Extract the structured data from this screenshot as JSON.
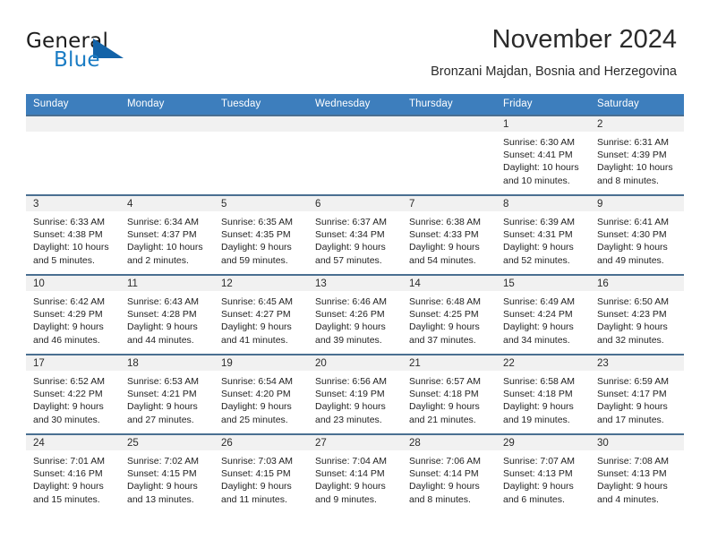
{
  "brand": {
    "name_top": "General",
    "name_bottom": "Blue",
    "triangle_color": "#1363a8",
    "blue_color": "#1a7cc4"
  },
  "header": {
    "month_title": "November 2024",
    "location": "Bronzani Majdan, Bosnia and Herzegovina"
  },
  "theme": {
    "header_blue": "#3d7ebd",
    "row_border": "#4a6f91",
    "daynum_band": "#f1f1f1"
  },
  "calendar": {
    "weekday_headers": [
      "Sunday",
      "Monday",
      "Tuesday",
      "Wednesday",
      "Thursday",
      "Friday",
      "Saturday"
    ],
    "weeks": [
      [
        {
          "day": "",
          "sunrise": "",
          "sunset": "",
          "daylight": ""
        },
        {
          "day": "",
          "sunrise": "",
          "sunset": "",
          "daylight": ""
        },
        {
          "day": "",
          "sunrise": "",
          "sunset": "",
          "daylight": ""
        },
        {
          "day": "",
          "sunrise": "",
          "sunset": "",
          "daylight": ""
        },
        {
          "day": "",
          "sunrise": "",
          "sunset": "",
          "daylight": ""
        },
        {
          "day": "1",
          "sunrise": "Sunrise: 6:30 AM",
          "sunset": "Sunset: 4:41 PM",
          "daylight": "Daylight: 10 hours and 10 minutes."
        },
        {
          "day": "2",
          "sunrise": "Sunrise: 6:31 AM",
          "sunset": "Sunset: 4:39 PM",
          "daylight": "Daylight: 10 hours and 8 minutes."
        }
      ],
      [
        {
          "day": "3",
          "sunrise": "Sunrise: 6:33 AM",
          "sunset": "Sunset: 4:38 PM",
          "daylight": "Daylight: 10 hours and 5 minutes."
        },
        {
          "day": "4",
          "sunrise": "Sunrise: 6:34 AM",
          "sunset": "Sunset: 4:37 PM",
          "daylight": "Daylight: 10 hours and 2 minutes."
        },
        {
          "day": "5",
          "sunrise": "Sunrise: 6:35 AM",
          "sunset": "Sunset: 4:35 PM",
          "daylight": "Daylight: 9 hours and 59 minutes."
        },
        {
          "day": "6",
          "sunrise": "Sunrise: 6:37 AM",
          "sunset": "Sunset: 4:34 PM",
          "daylight": "Daylight: 9 hours and 57 minutes."
        },
        {
          "day": "7",
          "sunrise": "Sunrise: 6:38 AM",
          "sunset": "Sunset: 4:33 PM",
          "daylight": "Daylight: 9 hours and 54 minutes."
        },
        {
          "day": "8",
          "sunrise": "Sunrise: 6:39 AM",
          "sunset": "Sunset: 4:31 PM",
          "daylight": "Daylight: 9 hours and 52 minutes."
        },
        {
          "day": "9",
          "sunrise": "Sunrise: 6:41 AM",
          "sunset": "Sunset: 4:30 PM",
          "daylight": "Daylight: 9 hours and 49 minutes."
        }
      ],
      [
        {
          "day": "10",
          "sunrise": "Sunrise: 6:42 AM",
          "sunset": "Sunset: 4:29 PM",
          "daylight": "Daylight: 9 hours and 46 minutes."
        },
        {
          "day": "11",
          "sunrise": "Sunrise: 6:43 AM",
          "sunset": "Sunset: 4:28 PM",
          "daylight": "Daylight: 9 hours and 44 minutes."
        },
        {
          "day": "12",
          "sunrise": "Sunrise: 6:45 AM",
          "sunset": "Sunset: 4:27 PM",
          "daylight": "Daylight: 9 hours and 41 minutes."
        },
        {
          "day": "13",
          "sunrise": "Sunrise: 6:46 AM",
          "sunset": "Sunset: 4:26 PM",
          "daylight": "Daylight: 9 hours and 39 minutes."
        },
        {
          "day": "14",
          "sunrise": "Sunrise: 6:48 AM",
          "sunset": "Sunset: 4:25 PM",
          "daylight": "Daylight: 9 hours and 37 minutes."
        },
        {
          "day": "15",
          "sunrise": "Sunrise: 6:49 AM",
          "sunset": "Sunset: 4:24 PM",
          "daylight": "Daylight: 9 hours and 34 minutes."
        },
        {
          "day": "16",
          "sunrise": "Sunrise: 6:50 AM",
          "sunset": "Sunset: 4:23 PM",
          "daylight": "Daylight: 9 hours and 32 minutes."
        }
      ],
      [
        {
          "day": "17",
          "sunrise": "Sunrise: 6:52 AM",
          "sunset": "Sunset: 4:22 PM",
          "daylight": "Daylight: 9 hours and 30 minutes."
        },
        {
          "day": "18",
          "sunrise": "Sunrise: 6:53 AM",
          "sunset": "Sunset: 4:21 PM",
          "daylight": "Daylight: 9 hours and 27 minutes."
        },
        {
          "day": "19",
          "sunrise": "Sunrise: 6:54 AM",
          "sunset": "Sunset: 4:20 PM",
          "daylight": "Daylight: 9 hours and 25 minutes."
        },
        {
          "day": "20",
          "sunrise": "Sunrise: 6:56 AM",
          "sunset": "Sunset: 4:19 PM",
          "daylight": "Daylight: 9 hours and 23 minutes."
        },
        {
          "day": "21",
          "sunrise": "Sunrise: 6:57 AM",
          "sunset": "Sunset: 4:18 PM",
          "daylight": "Daylight: 9 hours and 21 minutes."
        },
        {
          "day": "22",
          "sunrise": "Sunrise: 6:58 AM",
          "sunset": "Sunset: 4:18 PM",
          "daylight": "Daylight: 9 hours and 19 minutes."
        },
        {
          "day": "23",
          "sunrise": "Sunrise: 6:59 AM",
          "sunset": "Sunset: 4:17 PM",
          "daylight": "Daylight: 9 hours and 17 minutes."
        }
      ],
      [
        {
          "day": "24",
          "sunrise": "Sunrise: 7:01 AM",
          "sunset": "Sunset: 4:16 PM",
          "daylight": "Daylight: 9 hours and 15 minutes."
        },
        {
          "day": "25",
          "sunrise": "Sunrise: 7:02 AM",
          "sunset": "Sunset: 4:15 PM",
          "daylight": "Daylight: 9 hours and 13 minutes."
        },
        {
          "day": "26",
          "sunrise": "Sunrise: 7:03 AM",
          "sunset": "Sunset: 4:15 PM",
          "daylight": "Daylight: 9 hours and 11 minutes."
        },
        {
          "day": "27",
          "sunrise": "Sunrise: 7:04 AM",
          "sunset": "Sunset: 4:14 PM",
          "daylight": "Daylight: 9 hours and 9 minutes."
        },
        {
          "day": "28",
          "sunrise": "Sunrise: 7:06 AM",
          "sunset": "Sunset: 4:14 PM",
          "daylight": "Daylight: 9 hours and 8 minutes."
        },
        {
          "day": "29",
          "sunrise": "Sunrise: 7:07 AM",
          "sunset": "Sunset: 4:13 PM",
          "daylight": "Daylight: 9 hours and 6 minutes."
        },
        {
          "day": "30",
          "sunrise": "Sunrise: 7:08 AM",
          "sunset": "Sunset: 4:13 PM",
          "daylight": "Daylight: 9 hours and 4 minutes."
        }
      ]
    ]
  }
}
